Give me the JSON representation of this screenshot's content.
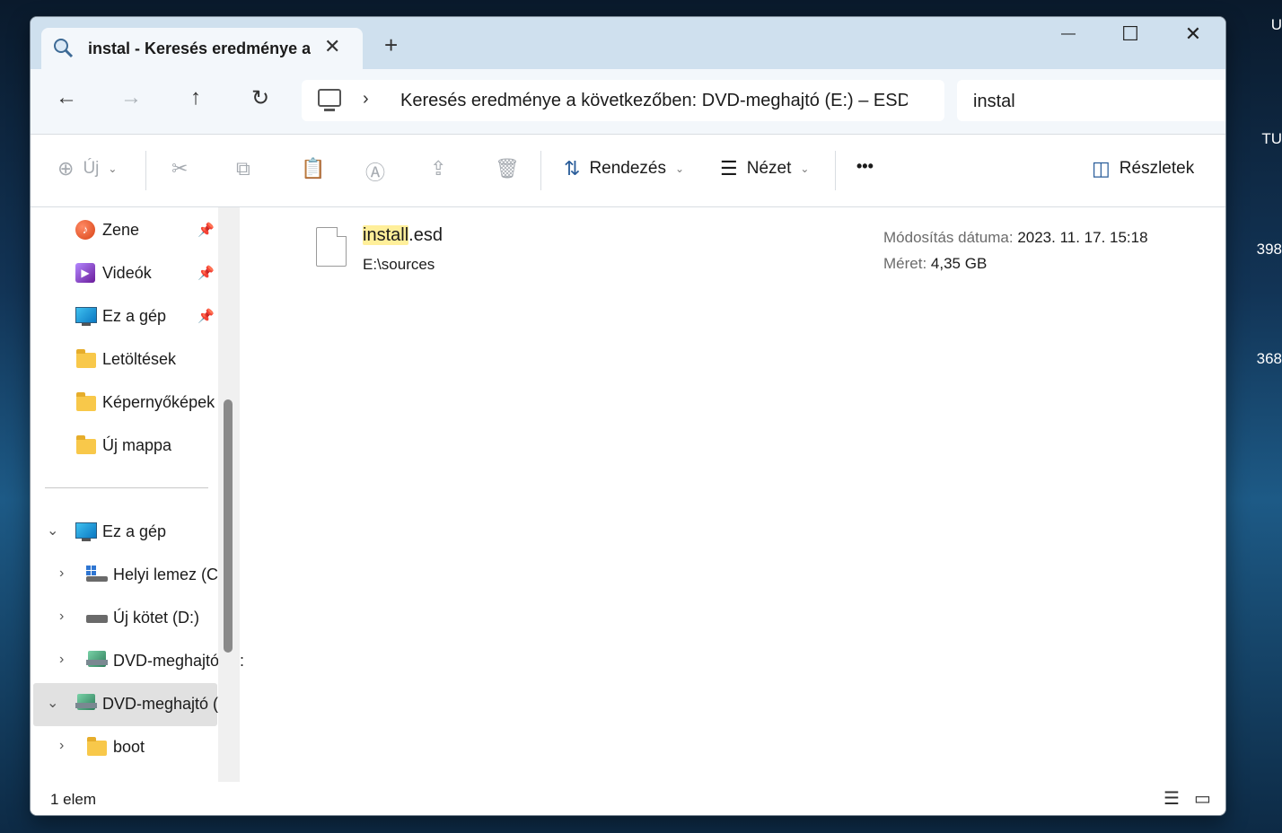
{
  "desktop": {
    "edge_texts": [
      "U",
      "TU",
      "398",
      "368"
    ]
  },
  "tab": {
    "title": "instal - Keresés eredménye a k",
    "close": "✕",
    "new_tab": "+"
  },
  "window_controls": {
    "minimize": "—",
    "maximize": "☐",
    "close": "✕"
  },
  "nav": {
    "back": "←",
    "forward": "→",
    "up": "↑",
    "refresh": "↻",
    "breadcrumb_chevron": "›",
    "address_path": "Keresés eredménye a következőben: DVD-meghajtó (E:) – ESD-ISO",
    "search_value": "instal"
  },
  "toolbar": {
    "new_label": "Új",
    "sort_label": "Rendezés",
    "view_label": "Nézet",
    "more_label": "•••",
    "details_label": "Részletek",
    "icons": [
      "plus-circle-icon",
      "cut-icon",
      "copy-icon",
      "paste-icon",
      "rename-icon",
      "share-icon",
      "delete-icon",
      "sort-icon",
      "view-icon",
      "more-icon",
      "details-pane-icon"
    ]
  },
  "sidebar": {
    "quick": [
      {
        "label": "Zene",
        "icon": "music-icon",
        "pinned": true
      },
      {
        "label": "Videók",
        "icon": "video-icon",
        "pinned": true
      },
      {
        "label": "Ez a gép",
        "icon": "computer-icon",
        "pinned": true
      },
      {
        "label": "Letöltések",
        "icon": "folder-icon",
        "pinned": false
      },
      {
        "label": "Képernyőképek",
        "icon": "folder-icon",
        "pinned": false
      },
      {
        "label": "Új mappa",
        "icon": "folder-icon",
        "pinned": false
      }
    ],
    "tree": [
      {
        "label": "Ez a gép",
        "icon": "computer-icon",
        "expanded": true
      },
      {
        "label": "Helyi lemez (C:)",
        "icon": "windows-drive-icon"
      },
      {
        "label": "Új kötet (D:)",
        "icon": "drive-icon"
      },
      {
        "label": "DVD-meghajtó (E:)",
        "icon": "dvd-icon"
      },
      {
        "label": "DVD-meghajtó (E:)",
        "icon": "dvd-icon",
        "selected": true,
        "expanded": true
      },
      {
        "label": "boot",
        "icon": "folder-icon"
      }
    ]
  },
  "results": [
    {
      "name_highlight": "install",
      "name_rest": ".esd",
      "location": "E:\\sources",
      "modified_label": "Módosítás dátuma:",
      "modified_value": "2023. 11. 17. 15:18",
      "size_label": "Méret:",
      "size_value": "4,35 GB"
    }
  ],
  "status": {
    "count": "1 elem"
  },
  "colors": {
    "titlebar": "#cfe0ee",
    "navbar": "#f3f7fb",
    "selection": "#e1e1e1",
    "highlight": "#ffef9a"
  }
}
